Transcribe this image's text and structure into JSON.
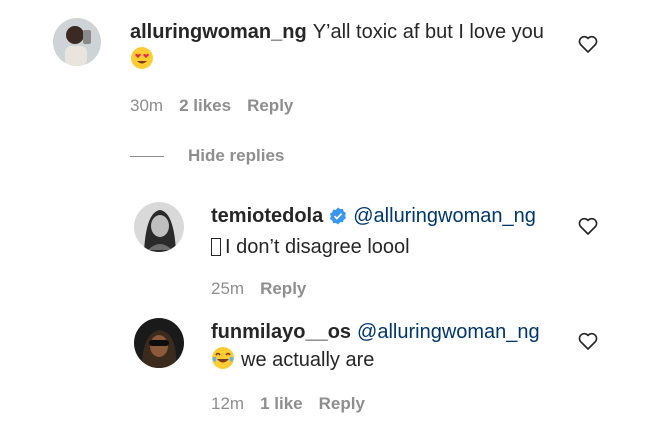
{
  "comment": {
    "username": "alluringwoman_ng",
    "text": "Y’all toxic af but I love you",
    "emoji": "heart-eyes-emoji",
    "time": "30m",
    "likes": "2 likes",
    "reply": "Reply"
  },
  "hide_replies": "Hide replies",
  "replies": [
    {
      "username": "temiotedola",
      "verified": true,
      "mention": "@alluringwoman_ng",
      "text": "I don’t disagree loool",
      "time": "25m",
      "reply": "Reply"
    },
    {
      "username": "funmilayo__os",
      "mention": "@alluringwoman_ng",
      "emoji": "tears-of-joy-emoji",
      "text": "we actually are",
      "time": "12m",
      "likes": "1 like",
      "reply": "Reply"
    }
  ],
  "colors": {
    "text": "#262626",
    "meta": "#8e8e8e",
    "mention": "#00376b",
    "verified": "#3897f0"
  }
}
